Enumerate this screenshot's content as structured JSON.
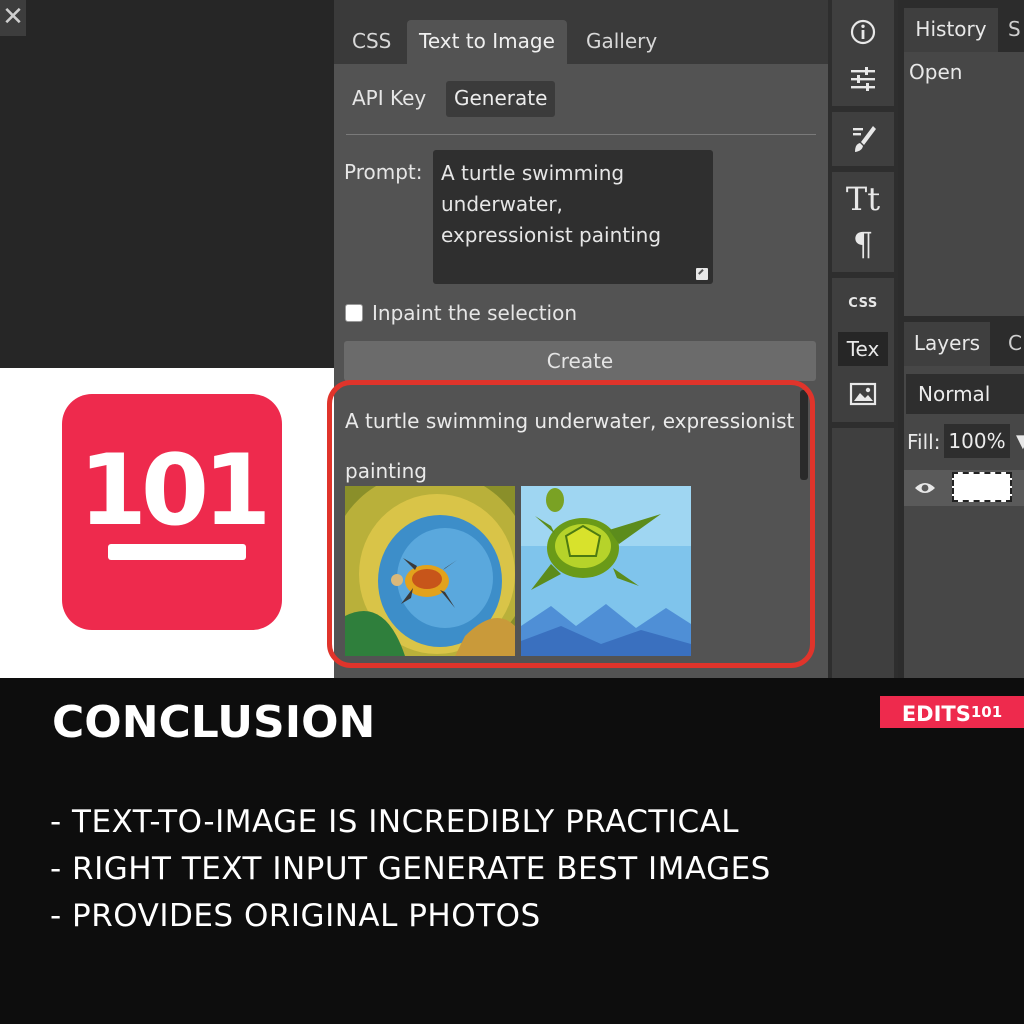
{
  "app": {
    "close_symbol": "✕"
  },
  "logo": {
    "text": "101",
    "color": "#ee2a4d"
  },
  "panel": {
    "tabs": [
      {
        "label": "CSS",
        "active": false
      },
      {
        "label": "Text to Image",
        "active": true
      },
      {
        "label": "Gallery",
        "active": false
      }
    ],
    "api_key_label": "API Key",
    "generate_label": "Generate",
    "prompt_label": "Prompt:",
    "prompt_value": "A turtle swimming\nunderwater,\nexpressionist painting",
    "inpaint_label": "Inpaint the selection",
    "inpaint_checked": false,
    "create_label": "Create",
    "result_caption": "A turtle swimming underwater, expressionist painting",
    "highlight_color": "#e0342b"
  },
  "toolbar": {
    "icons": [
      "info-icon",
      "adjustments-icon",
      "brush-icon",
      "text-icon",
      "paragraph-icon",
      "css-icon",
      "text-to-image-icon",
      "image-icon"
    ],
    "css_label": "CSS",
    "tex_label": "Tex"
  },
  "history": {
    "tab_label": "History",
    "tab2_label": "S",
    "items": [
      "Open"
    ]
  },
  "layers": {
    "tab_label": "Layers",
    "tab2_label": "C",
    "blend_mode": "Normal",
    "fill_label": "Fill:",
    "fill_value": "100%"
  },
  "caption": {
    "heading": "CONCLUSION",
    "brand": "EDITS",
    "brand_sup": "101",
    "bullets": [
      "- TEXT-TO-IMAGE IS INCREDIBLY PRACTICAL",
      "- RIGHT TEXT INPUT GENERATE BEST IMAGES",
      "- PROVIDES ORIGINAL PHOTOS"
    ]
  }
}
